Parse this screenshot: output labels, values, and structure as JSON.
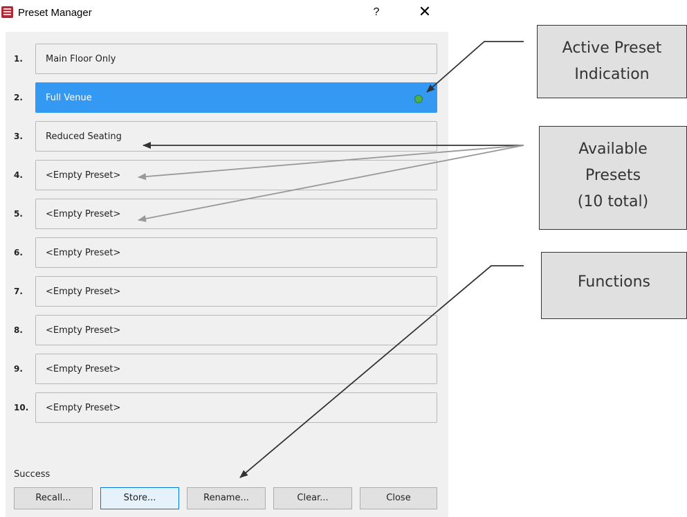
{
  "window": {
    "title": "Preset Manager",
    "help_label": "?",
    "close_label": "✕",
    "app_icon": "preset-manager-icon"
  },
  "presets": [
    {
      "number": "1.",
      "name": "Main Floor Only",
      "active": false
    },
    {
      "number": "2.",
      "name": "Full Venue",
      "active": true
    },
    {
      "number": "3.",
      "name": "Reduced Seating",
      "active": false
    },
    {
      "number": "4.",
      "name": "<Empty Preset>",
      "active": false
    },
    {
      "number": "5.",
      "name": "<Empty Preset>",
      "active": false
    },
    {
      "number": "6.",
      "name": "<Empty Preset>",
      "active": false
    },
    {
      "number": "7.",
      "name": "<Empty Preset>",
      "active": false
    },
    {
      "number": "8.",
      "name": "<Empty Preset>",
      "active": false
    },
    {
      "number": "9.",
      "name": "<Empty Preset>",
      "active": false
    },
    {
      "number": "10.",
      "name": "<Empty Preset>",
      "active": false
    }
  ],
  "status": "Success",
  "buttons": {
    "recall": "Recall...",
    "store": "Store...",
    "rename": "Rename...",
    "clear": "Clear...",
    "close": "Close"
  },
  "callouts": {
    "active_preset": [
      "Active Preset",
      "Indication"
    ],
    "available_presets": [
      "Available",
      "Presets",
      "(10 total)"
    ],
    "functions": [
      "Functions"
    ]
  },
  "colors": {
    "active_highlight": "#3399f3",
    "active_indicator": "#4caf50",
    "dialog_background": "#f0f0f0",
    "callout_background": "#e0e0e0"
  }
}
